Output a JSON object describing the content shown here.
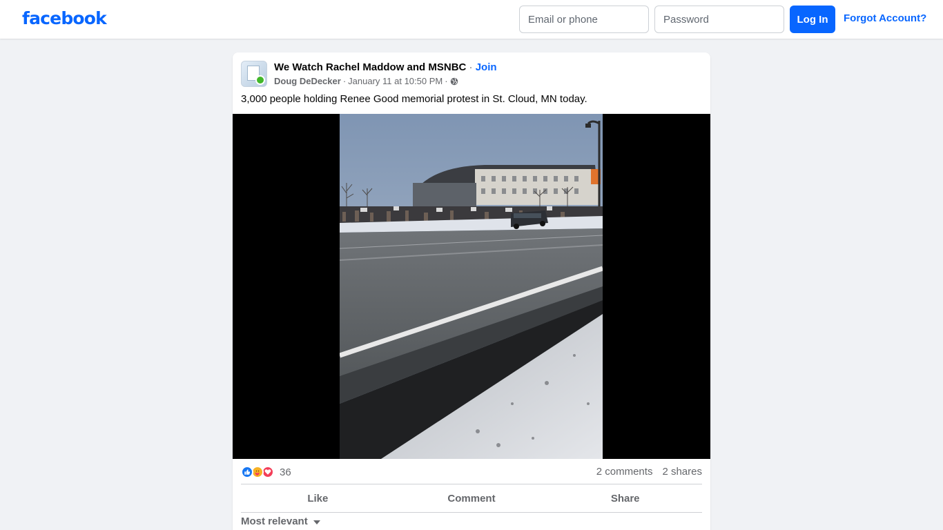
{
  "header": {
    "logo": "facebook",
    "email_placeholder": "Email or phone",
    "password_placeholder": "Password",
    "login_label": "Log In",
    "forgot_label": "Forgot Account?"
  },
  "post": {
    "group_name": "We Watch Rachel Maddow and MSNBC",
    "join_label": "Join",
    "author": "Doug DeDecker",
    "timestamp": "January 11 at 10:50 PM",
    "privacy_icon": "globe-icon",
    "text": "3,000 people holding Renee Good memorial protest in St. Cloud, MN today.",
    "media": "video-player"
  },
  "engagement": {
    "reaction_icons": [
      "like-reaction-icon",
      "care-reaction-icon",
      "love-reaction-icon"
    ],
    "reaction_count": "36",
    "comments": "2 comments",
    "shares": "2 shares",
    "like_label": "Like",
    "comment_label": "Comment",
    "share_label": "Share",
    "sort_label": "Most relevant"
  },
  "colors": {
    "brand": "#0866ff",
    "background": "#f0f2f5",
    "secondary_text": "#65676b"
  }
}
